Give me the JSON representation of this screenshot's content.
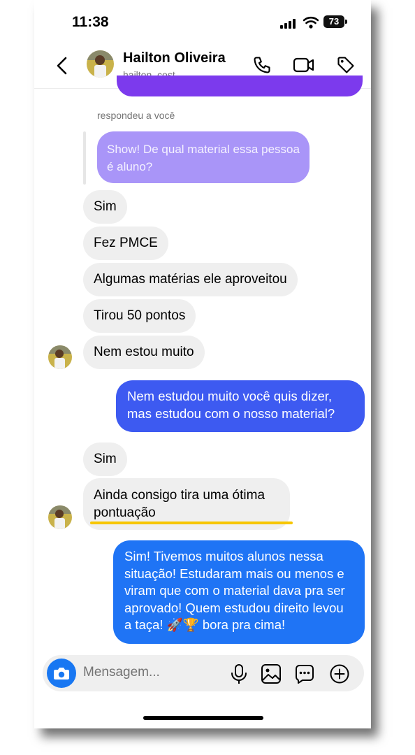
{
  "status": {
    "time": "11:38",
    "battery": "73"
  },
  "header": {
    "name": "Hailton Oliveira",
    "username": "hailton_cost"
  },
  "reply": {
    "label": "respondeu a você",
    "quoted": "Show! De qual material essa pessoa é aluno?"
  },
  "messages": {
    "in1": "Sim",
    "in2": "Fez PMCE",
    "in3": "Algumas matérias ele aproveitou",
    "in4": "Tirou 50 pontos",
    "in5": "Nem estou muito",
    "out1": "Nem estudou muito você quis dizer, mas estudou com o nosso material?",
    "in6": "Sim",
    "in7": "Ainda consigo tira uma ótima pontuação",
    "out2": "Sim! Tivemos muitos alunos nessa situação! Estudaram mais ou menos e viram que com o material dava pra ser aprovado! Quem estudou direito levou a taça! 🚀🏆 bora pra cima!"
  },
  "composer": {
    "placeholder": "Mensagem..."
  },
  "icons": [
    "back-icon",
    "phone-icon",
    "video-icon",
    "tag-icon",
    "camera-icon",
    "microphone-icon",
    "gallery-icon",
    "sticker-icon",
    "plus-icon"
  ],
  "colors": {
    "outgoing_purple": "#7c3aed",
    "outgoing_blue_mid": "#3d5af1",
    "outgoing_blue": "#1f74f5",
    "reply_bubble": "#a995f8",
    "incoming": "#efefef",
    "highlight": "#f7c600"
  }
}
